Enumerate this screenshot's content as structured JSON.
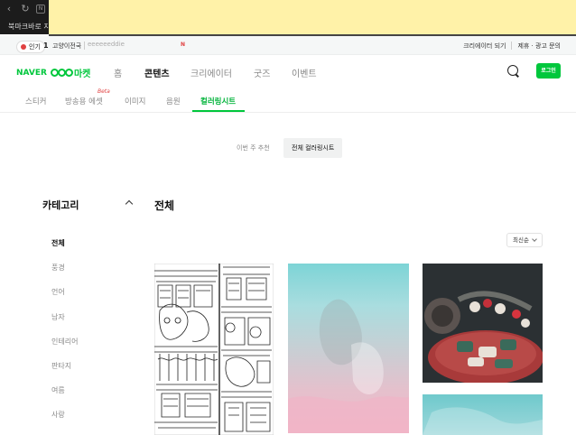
{
  "browser": {
    "bookmark_text": "북마크바로 지정"
  },
  "ticker": {
    "hot_label": "인기",
    "rank": "1",
    "keyword": "고양이전국",
    "search_text": "eeeeeeddie",
    "n_mark": "N",
    "creator_link": "크리에이터 되기",
    "ad_link": "제휴 · 광고 문의"
  },
  "header": {
    "logo_naver": "NAVER",
    "logo_market": "마켓",
    "nav": [
      "홈",
      "콘텐츠",
      "크리에이터",
      "굿즈",
      "이벤트"
    ],
    "active_nav": "콘텐츠",
    "login_label": "로그인"
  },
  "subtabs": {
    "items": [
      "스티커",
      "방송용 에셋",
      "이미지",
      "음원",
      "컬러링시트"
    ],
    "active": "컬러링시트",
    "beta_label": "Beta"
  },
  "toggle": {
    "options": [
      "이번 주 추천",
      "전체 컬러링시트"
    ],
    "selected": "전체 컬러링시트"
  },
  "sidebar": {
    "title": "카테고리",
    "categories": [
      "전체",
      "풍경",
      "언어",
      "남자",
      "인테리어",
      "판타지",
      "여름",
      "사랑"
    ],
    "active": "전체"
  },
  "main": {
    "title": "전체",
    "sort_label": "최신순"
  },
  "colors": {
    "accent": "#00c73c",
    "ticker_bg": "#f5f7f7",
    "chrome_bg": "#1c1c1c",
    "notice_bg": "#fff2a8"
  }
}
